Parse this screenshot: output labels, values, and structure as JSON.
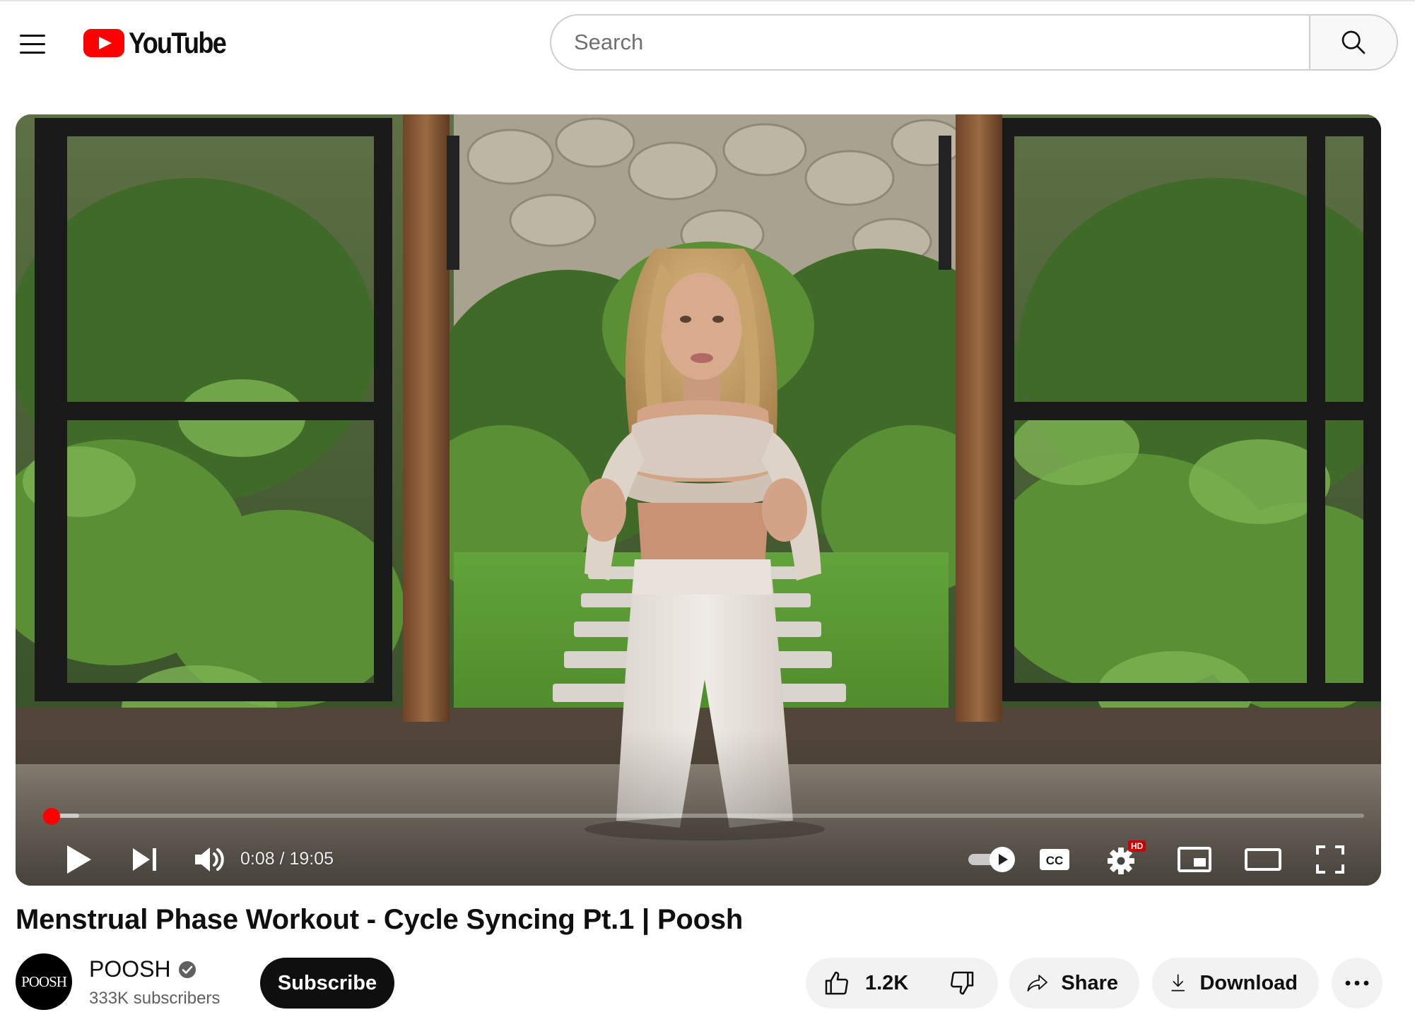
{
  "header": {
    "logo_text": "YouTube",
    "search_placeholder": "Search"
  },
  "player": {
    "current_time": "0:08",
    "duration": "19:05",
    "time_display": "0:08 / 19:05",
    "progress_fraction": 0.007,
    "buffered_fraction": 0.028,
    "hd_badge": "HD",
    "autoplay_on": true,
    "colors": {
      "progress": "#ff0000",
      "controls": "#ffffff"
    }
  },
  "video": {
    "title": "Menstrual Phase Workout - Cycle Syncing Pt.1 | Poosh"
  },
  "channel": {
    "avatar_text": "POOSH",
    "name": "POOSH",
    "verified": true,
    "subscribers": "333K subscribers",
    "subscribe_label": "Subscribe"
  },
  "actions": {
    "like_count": "1.2K",
    "share_label": "Share",
    "download_label": "Download"
  },
  "icons": [
    "menu-icon",
    "youtube-logo-icon",
    "search-icon",
    "play-icon",
    "next-icon",
    "volume-icon",
    "autoplay-toggle-icon",
    "captions-icon",
    "settings-icon",
    "miniplayer-icon",
    "theater-mode-icon",
    "fullscreen-icon",
    "verified-icon",
    "like-icon",
    "dislike-icon",
    "share-icon",
    "download-icon",
    "more-icon"
  ]
}
